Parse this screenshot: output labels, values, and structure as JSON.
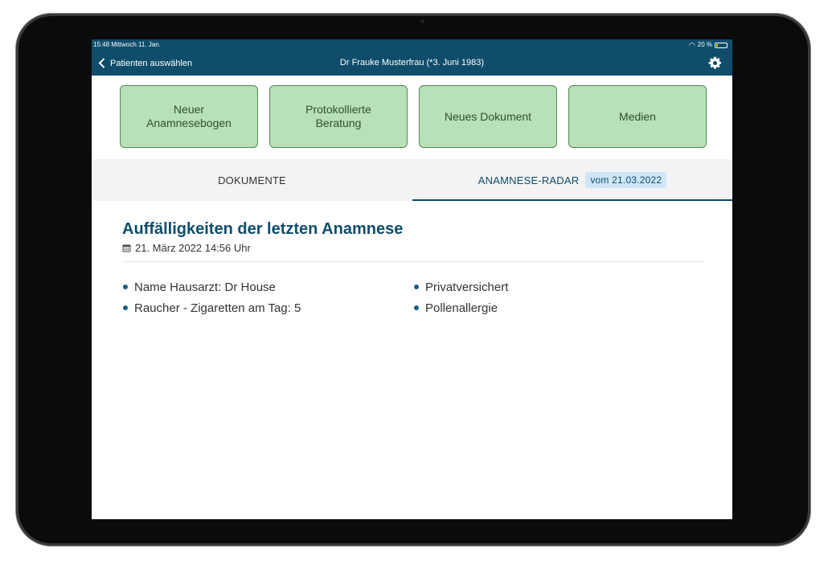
{
  "statusbar": {
    "time": "15:48",
    "date": "Mittwoch 11. Jan.",
    "battery": "20 %",
    "battery_level": 0.2,
    "battery_color": "#f5d000"
  },
  "navbar": {
    "back_label": "Patienten auswählen",
    "title": "Dr Frauke Musterfrau (*3. Juni 1983)",
    "background": "#0f4d6b"
  },
  "actions": [
    {
      "label": "Neuer\nAnamnesebogen"
    },
    {
      "label": "Protokollierte\nBeratung"
    },
    {
      "label": "Neues Dokument"
    },
    {
      "label": "Medien"
    }
  ],
  "tabs": {
    "documents": "DOKUMENTE",
    "radar": "ANAMNESE-RADAR",
    "radar_badge": "vom 21.03.2022",
    "active": "radar"
  },
  "main": {
    "title": "Auffälligkeiten der letzten Anamnese",
    "date": "21. März 2022 14:56 Uhr",
    "left_items": [
      "Name Hausarzt: Dr House",
      "Raucher - Zigaretten am Tag: 5"
    ],
    "right_items": [
      "Privatversichert",
      "Pollenallergie"
    ]
  },
  "icons": {
    "back": "chevron-left-icon",
    "settings": "gear-icon",
    "calendar": "calendar-icon",
    "wifi": "wifi-icon",
    "battery": "battery-icon"
  },
  "colors": {
    "accent": "#0f4d6b",
    "tile_bg": "#b8e1b8",
    "tile_border": "#4f8a4f",
    "badge_bg": "#cfe6f7"
  }
}
